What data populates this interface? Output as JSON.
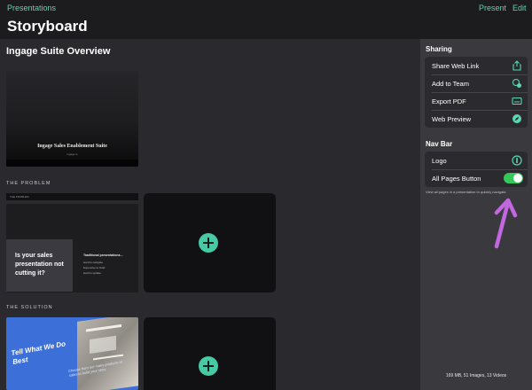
{
  "nav": {
    "back_label": "Presentations",
    "present_label": "Present",
    "edit_label": "Edit",
    "page_title": "Storyboard"
  },
  "storyboard": {
    "title": "Ingage Suite Overview",
    "cover": {
      "title": "Ingage Sales Enablement Suite",
      "subtitle": "ingage.io"
    },
    "chapters": [
      {
        "label": "THE PROBLEM",
        "slide": {
          "strip_label": "THE PROBLEM",
          "question": "Is your sales presentation not cutting it?",
          "list_title": "Traditional presentations...",
          "list_items": [
            "Hard to navigate",
            "Expensive to build",
            "Hard to update"
          ]
        }
      },
      {
        "label": "THE SOLUTION",
        "slide": {
          "headline": "Tell What We Do Best",
          "caption": "Choose from our many products or sales to build your story"
        }
      }
    ]
  },
  "sidebar": {
    "sharing_heading": "Sharing",
    "sharing_items": [
      {
        "label": "Share Web Link",
        "icon": "share-icon"
      },
      {
        "label": "Add to Team",
        "icon": "team-icon"
      },
      {
        "label": "Export PDF",
        "icon": "pdf-icon"
      },
      {
        "label": "Web Preview",
        "icon": "compass-icon"
      }
    ],
    "nav_heading": "Nav Bar",
    "nav_items": [
      {
        "label": "Logo",
        "icon": "logo-icon"
      },
      {
        "label": "All Pages Button",
        "toggle_on": true
      }
    ],
    "hint": "View all pages in a presentation to quickly navigate.",
    "storage": "169 MB, 51 Images, 13 Videos"
  },
  "colors": {
    "accent": "#5ad6b0",
    "add_button": "#46c9a5",
    "toggle_on": "#34c759",
    "annotation_arrow": "#c267e0"
  }
}
